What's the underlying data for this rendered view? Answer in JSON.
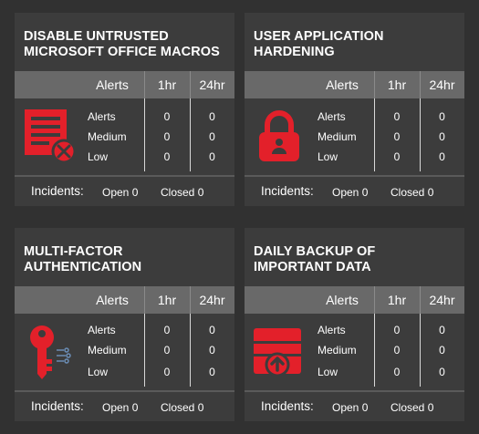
{
  "labels": {
    "alerts_header": "Alerts",
    "h1_header": "1hr",
    "h24_header": "24hr",
    "row_alerts": "Alerts",
    "row_medium": "Medium",
    "row_low": "Low",
    "incidents": "Incidents:",
    "open_prefix": "Open",
    "closed_prefix": "Closed"
  },
  "accent_color": "#e3202a",
  "cards": [
    {
      "title_line1": "DISABLE UNTRUSTED",
      "title_line2": "MICROSOFT OFFICE MACROS",
      "icon": "document-blocked-icon",
      "alerts_1hr": "0",
      "alerts_24hr": "0",
      "medium_1hr": "0",
      "medium_24hr": "0",
      "low_1hr": "0",
      "low_24hr": "0",
      "open": "Open 0",
      "closed": "Closed 0"
    },
    {
      "title_line1": "USER APPLICATION",
      "title_line2": "HARDENING",
      "icon": "padlock-user-icon",
      "alerts_1hr": "0",
      "alerts_24hr": "0",
      "medium_1hr": "0",
      "medium_24hr": "0",
      "low_1hr": "0",
      "low_24hr": "0",
      "open": "Open 0",
      "closed": "Closed 0"
    },
    {
      "title_line1": "MULTI-FACTOR",
      "title_line2": "AUTHENTICATION",
      "icon": "key-icon",
      "alerts_1hr": "0",
      "alerts_24hr": "0",
      "medium_1hr": "0",
      "medium_24hr": "0",
      "low_1hr": "0",
      "low_24hr": "0",
      "open": "Open 0",
      "closed": "Closed 0"
    },
    {
      "title_line1": "DAILY BACKUP OF",
      "title_line2": "IMPORTANT DATA",
      "icon": "backup-upload-icon",
      "alerts_1hr": "0",
      "alerts_24hr": "0",
      "medium_1hr": "0",
      "medium_24hr": "0",
      "low_1hr": "0",
      "low_24hr": "0",
      "open": "Open 0",
      "closed": "Closed 0"
    }
  ]
}
